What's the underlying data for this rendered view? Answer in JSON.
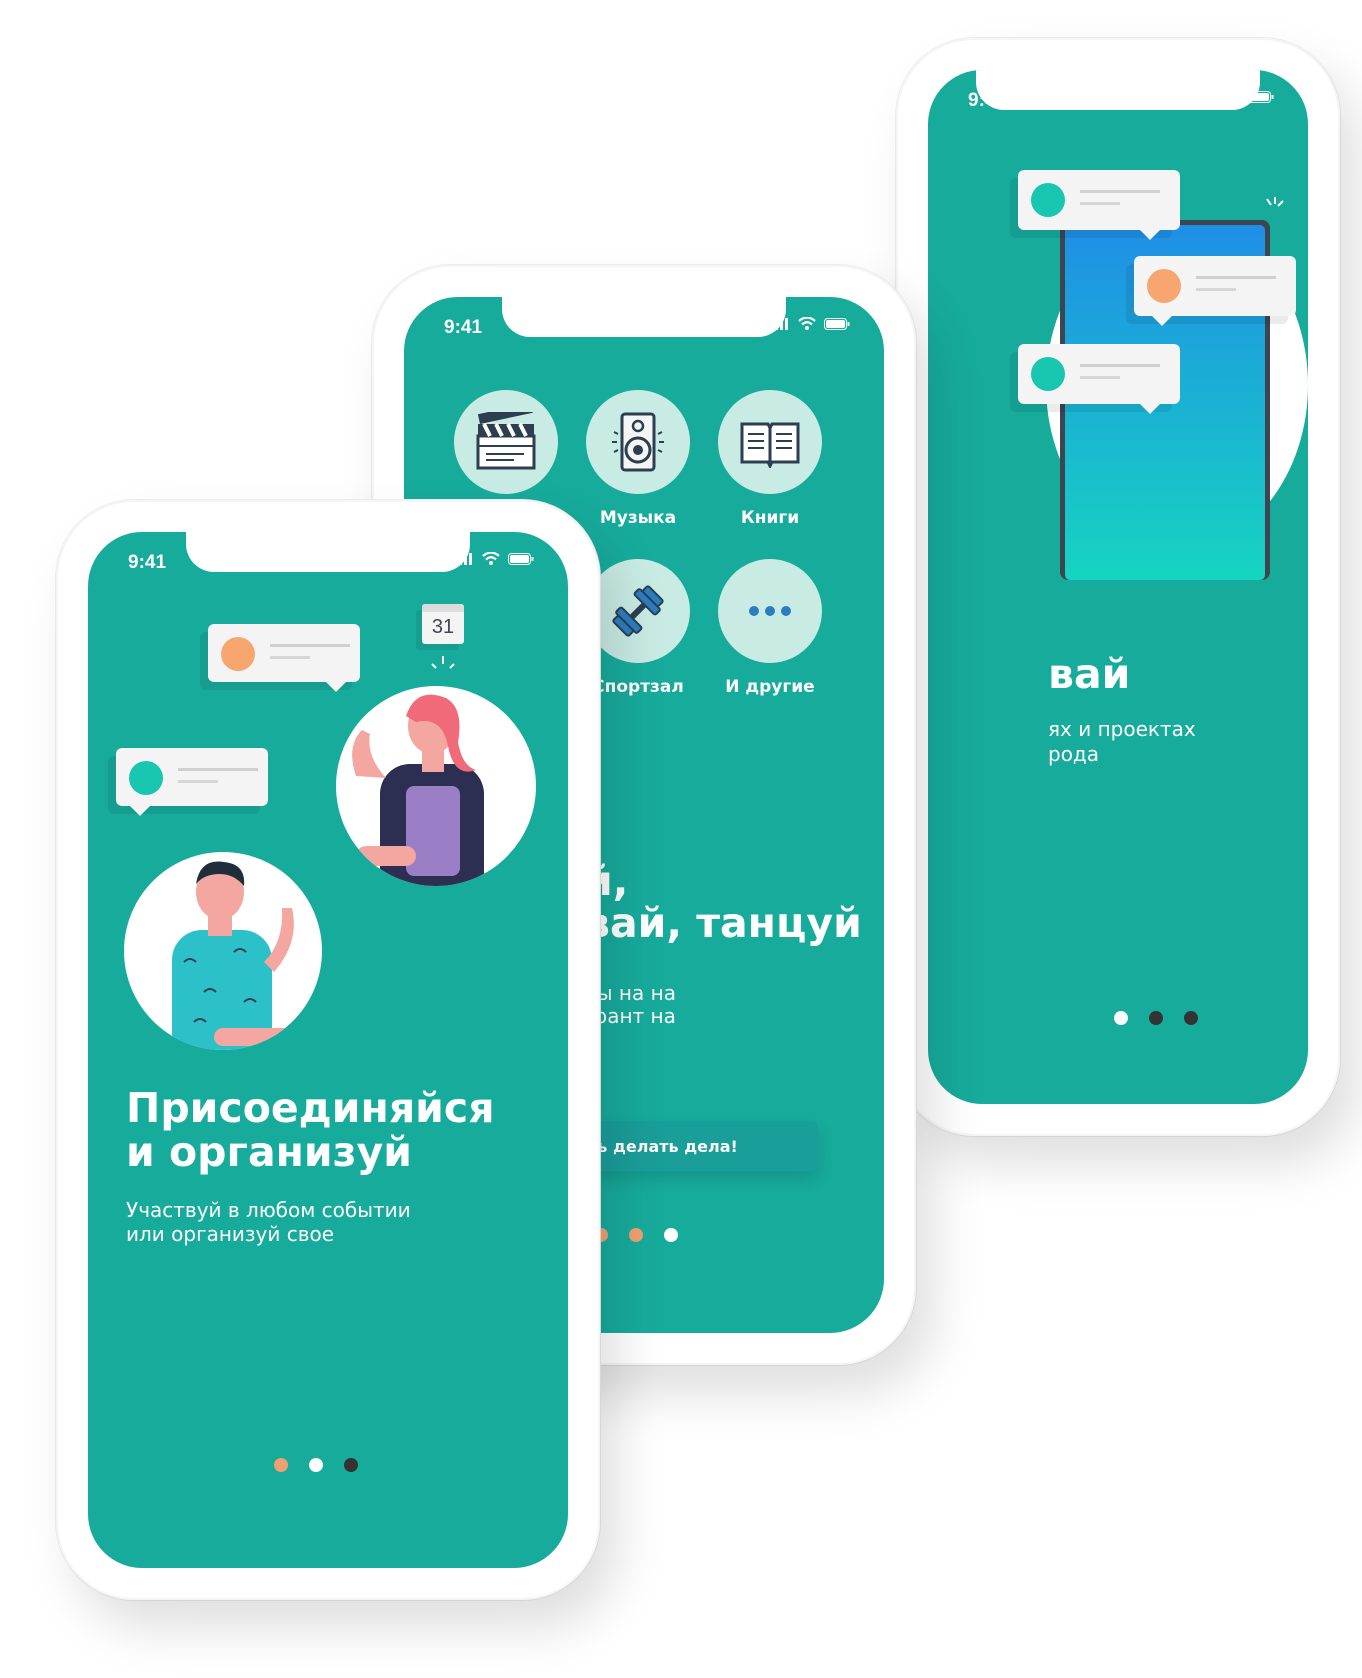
{
  "status_bar": {
    "time": "9:41"
  },
  "phone_right": {
    "headline": "вай",
    "subtitle_lines": [
      "ях и проектах",
      "рода"
    ],
    "colors": {
      "screen": "#17ab9c",
      "device_top": "#1f8fe6",
      "device_bottom": "#16d4c1"
    }
  },
  "phone_middle": {
    "categories": [
      {
        "label": "",
        "icon": "clapperboard-icon"
      },
      {
        "label": "Музыка",
        "icon": "speaker-icon"
      },
      {
        "label": "Книги",
        "icon": "book-icon"
      },
      {
        "label": "Спортзал",
        "icon": "dumbbell-icon"
      },
      {
        "label": "И другие",
        "icon": "more-dots-icon"
      }
    ],
    "headline_lines": [
      "й,",
      "вай, танцуй"
    ],
    "subtitle_lines": [
      "лы на на",
      "грант на"
    ],
    "cta_label": "ть делать дела!"
  },
  "phone_front": {
    "headline_lines": [
      "Присоединяйся",
      "и организуй"
    ],
    "subtitle_lines": [
      "Участвуй в любом событии",
      "или организуй свое"
    ],
    "calendar_day": "31"
  },
  "colors": {
    "teal": "#17ab9c",
    "orange_dot": "#f0a070",
    "white_dot": "#ffffff",
    "dark_dot": "#333333"
  }
}
